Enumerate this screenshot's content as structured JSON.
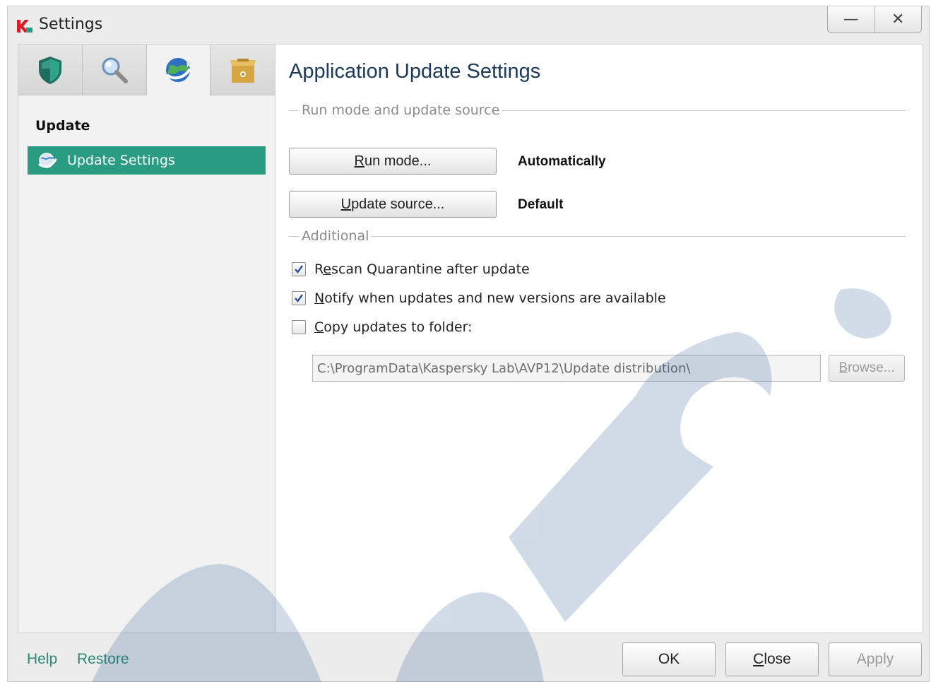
{
  "window": {
    "title": "Settings",
    "minimize_glyph": "—",
    "close_glyph": "✕"
  },
  "sidebar": {
    "tabs": [
      {
        "icon": "shield-icon"
      },
      {
        "icon": "magnifier-icon"
      },
      {
        "icon": "globe-update-icon",
        "active": true
      },
      {
        "icon": "box-icon"
      }
    ],
    "section": "Update",
    "items": [
      {
        "label": "Update Settings",
        "icon": "update-globe-icon",
        "selected": true
      }
    ]
  },
  "main": {
    "title": "Application Update Settings",
    "run_group": {
      "header": "Run mode and update source",
      "run_mode_button": {
        "prefix": "",
        "accel": "R",
        "rest": "un mode..."
      },
      "run_mode_value": "Automatically",
      "update_source_button": {
        "prefix": "",
        "accel": "U",
        "rest": "pdate source..."
      },
      "update_source_value": "Default"
    },
    "additional_group": {
      "header": "Additional",
      "options": [
        {
          "accel_prefix": "R",
          "accel": "e",
          "rest": "scan Quarantine after update",
          "checked": true
        },
        {
          "accel_prefix": "",
          "accel": "N",
          "rest": "otify when updates and new versions are available",
          "checked": true
        },
        {
          "accel_prefix": "",
          "accel": "C",
          "rest": "opy updates to folder:",
          "checked": false
        }
      ],
      "folder_path": "C:\\ProgramData\\Kaspersky Lab\\AVP12\\Update distribution\\",
      "browse": {
        "accel": "B",
        "rest": "rowse..."
      }
    }
  },
  "footer": {
    "help": "Help",
    "restore": "Restore",
    "ok": "OK",
    "close": {
      "accel": "C",
      "rest": "lose"
    },
    "apply": "Apply"
  },
  "colors": {
    "accent": "#2a9c82",
    "link": "#2a8a73",
    "title": "#1d3a5a",
    "watermark": "#1e4f8f"
  },
  "watermark_text": "edco"
}
